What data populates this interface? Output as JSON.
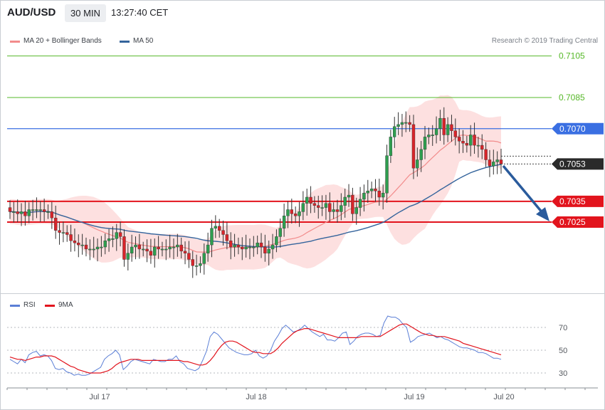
{
  "header": {
    "symbol": "AUD/USD",
    "timeframe": "30 MIN",
    "clock": "13:27:40 CET"
  },
  "legend": {
    "ma20": "MA 20 + Bollinger Bands",
    "ma50": "MA 50",
    "rsi": "RSI",
    "ma9": "9MA"
  },
  "credit": "Research © 2019 Trading Central",
  "colors": {
    "bull": "#2e9e4f",
    "bear": "#d8242a",
    "ma20": "#f28b8b",
    "band_fill": "#fcd6d6",
    "ma50": "#34649c",
    "resistance": "#e2141d",
    "pivot": "#3a6fe2",
    "green_level": "#56b828",
    "rsi": "#5b7fd6",
    "rsi_ma": "#e2141d",
    "arrow": "#2a5b9c",
    "current": "#2a2a2a"
  },
  "chart_data": [
    {
      "type": "candlestick",
      "x_ticks": [
        "Jul 17",
        "Jul 18",
        "Jul 19",
        "Jul 20"
      ],
      "y_tick_labels": [
        "0.7105",
        "0.7085",
        "0.7070",
        "0.7053",
        "0.7035",
        "0.7025"
      ],
      "levels": [
        {
          "value": 0.7105,
          "label": "0.7105",
          "kind": "target"
        },
        {
          "value": 0.7085,
          "label": "0.7085",
          "kind": "target"
        },
        {
          "value": 0.707,
          "label": "0.7070",
          "kind": "pivot"
        },
        {
          "value": 0.7053,
          "label": "0.7053",
          "kind": "current"
        },
        {
          "value": 0.7035,
          "label": "0.7035",
          "kind": "support"
        },
        {
          "value": 0.7025,
          "label": "0.7025",
          "kind": "support"
        }
      ],
      "close": [
        0.703,
        0.703,
        0.7029,
        0.703,
        0.7028,
        0.7031,
        0.7031,
        0.7031,
        0.7031,
        0.703,
        0.703,
        0.7027,
        0.7021,
        0.702,
        0.702,
        0.7019,
        0.7016,
        0.7015,
        0.7014,
        0.7014,
        0.7012,
        0.7012,
        0.7012,
        0.7013,
        0.7013,
        0.7016,
        0.7017,
        0.7017,
        0.702,
        0.7018,
        0.7007,
        0.701,
        0.7013,
        0.7014,
        0.7012,
        0.7012,
        0.7011,
        0.7009,
        0.7013,
        0.7012,
        0.7012,
        0.7012,
        0.7013,
        0.7013,
        0.7014,
        0.7011,
        0.701,
        0.7007,
        0.7004,
        0.7004,
        0.7005,
        0.701,
        0.7014,
        0.7022,
        0.7023,
        0.7021,
        0.7019,
        0.7016,
        0.7013,
        0.7014,
        0.7013,
        0.7012,
        0.7013,
        0.7013,
        0.7013,
        0.7015,
        0.7013,
        0.701,
        0.7012,
        0.7014,
        0.7018,
        0.7022,
        0.7028,
        0.7031,
        0.7029,
        0.7028,
        0.703,
        0.7034,
        0.7037,
        0.7034,
        0.7033,
        0.7032,
        0.7032,
        0.7034,
        0.703,
        0.7031,
        0.703,
        0.7033,
        0.7037,
        0.7038,
        0.7029,
        0.7032,
        0.7036,
        0.7039,
        0.704,
        0.7041,
        0.704,
        0.7037,
        0.7039,
        0.7057,
        0.7066,
        0.7071,
        0.7072,
        0.7073,
        0.7073,
        0.7072,
        0.7051,
        0.7055,
        0.706,
        0.7066,
        0.7067,
        0.7067,
        0.707,
        0.7075,
        0.7067,
        0.7072,
        0.7069,
        0.7066,
        0.7064,
        0.7063,
        0.7062,
        0.7067,
        0.7062,
        0.7062,
        0.706,
        0.7055,
        0.7052,
        0.7054,
        0.7055,
        0.7053
      ],
      "rsi": {
        "ticks": [
          30,
          50,
          70
        ],
        "ylim": [
          18,
          88
        ],
        "rsi_values": [
          42,
          40,
          38,
          42,
          39,
          46,
          48,
          49,
          45,
          46,
          45,
          41,
          34,
          33,
          34,
          31,
          30,
          28,
          29,
          28,
          28,
          29,
          31,
          33,
          35,
          42,
          45,
          47,
          50,
          46,
          33,
          36,
          40,
          42,
          41,
          40,
          39,
          38,
          42,
          41,
          40,
          40,
          42,
          42,
          45,
          40,
          38,
          34,
          33,
          32,
          34,
          41,
          49,
          62,
          66,
          64,
          60,
          56,
          52,
          50,
          48,
          47,
          46,
          46,
          47,
          50,
          45,
          43,
          45,
          50,
          58,
          63,
          69,
          72,
          69,
          66,
          67,
          69,
          72,
          69,
          66,
          64,
          62,
          64,
          59,
          59,
          58,
          61,
          65,
          66,
          55,
          58,
          62,
          64,
          65,
          65,
          64,
          62,
          63,
          74,
          80,
          79,
          79,
          77,
          73,
          70,
          57,
          59,
          62,
          63,
          64,
          65,
          63,
          61,
          62,
          60,
          59,
          57,
          55,
          53,
          52,
          52,
          51,
          50,
          48,
          48,
          47,
          45,
          43,
          43,
          42
        ],
        "ma9_values": [
          44,
          43,
          42,
          42,
          41,
          42,
          43,
          44,
          44,
          45,
          45,
          45,
          44,
          42,
          40,
          38,
          36,
          35,
          33,
          32,
          31,
          30,
          30,
          30,
          30,
          31,
          32,
          34,
          37,
          39,
          40,
          41,
          42,
          42,
          42,
          41,
          41,
          41,
          41,
          41,
          41,
          41,
          41,
          41,
          41,
          41,
          40,
          40,
          39,
          38,
          37,
          37,
          38,
          41,
          45,
          50,
          54,
          57,
          58,
          58,
          57,
          55,
          53,
          51,
          49,
          48,
          48,
          47,
          47,
          47,
          49,
          52,
          56,
          59,
          62,
          65,
          67,
          68,
          69,
          69,
          68,
          67,
          66,
          65,
          64,
          63,
          62,
          61,
          61,
          61,
          61,
          61,
          61,
          62,
          62,
          62,
          62,
          62,
          62,
          64,
          66,
          68,
          70,
          72,
          73,
          73,
          71,
          69,
          67,
          65,
          64,
          63,
          63,
          62,
          62,
          62,
          61,
          60,
          59,
          58,
          56,
          55,
          54,
          53,
          52,
          51,
          50,
          49,
          48,
          47,
          46
        ]
      }
    }
  ]
}
